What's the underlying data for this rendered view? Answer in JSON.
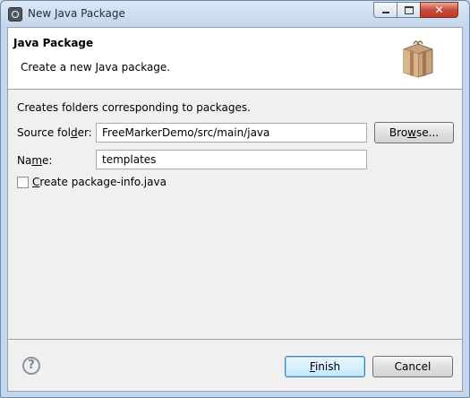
{
  "window": {
    "title": "New Java Package",
    "minimize": "minimize",
    "maximize": "maximize",
    "close": "close"
  },
  "banner": {
    "title": "Java Package",
    "description": "Create a new Java package.",
    "icon": "package-icon"
  },
  "form": {
    "intro": "Creates folders corresponding to packages.",
    "source_folder": {
      "label_pre": "Source fol",
      "label_mnemonic": "d",
      "label_post": "er:",
      "value": "FreeMarkerDemo/src/main/java"
    },
    "browse": {
      "label_pre": "Bro",
      "label_mnemonic": "w",
      "label_post": "se..."
    },
    "name": {
      "label_pre": "Na",
      "label_mnemonic": "m",
      "label_post": "e:",
      "value": "templates"
    },
    "create_package_info": {
      "label_mnemonic": "C",
      "label_post": "reate package-info.java",
      "checked": false
    }
  },
  "footer": {
    "help": "?",
    "finish": {
      "label_mnemonic": "F",
      "label_post": "inish"
    },
    "cancel": {
      "label": "Cancel"
    }
  },
  "colors": {
    "title_bg": "#c4d6ec",
    "close_button": "#c74d3a",
    "default_button_border": "#3c7fb1",
    "dialog_bg": "#f0f0f0"
  }
}
